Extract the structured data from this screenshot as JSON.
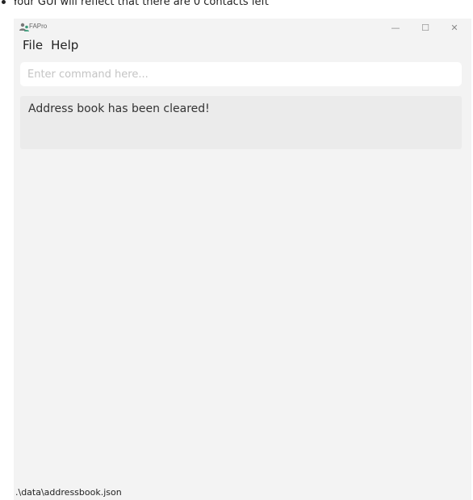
{
  "instruction": {
    "text": "Your GUI will reflect that there are 0 contacts left"
  },
  "window": {
    "title": "FAPro",
    "controls": {
      "minimize_glyph": "—",
      "maximize_glyph": "☐",
      "close_glyph": "✕"
    },
    "menu": [
      {
        "label": "File"
      },
      {
        "label": "Help"
      }
    ],
    "command": {
      "value": "",
      "placeholder": "Enter command here..."
    },
    "result": {
      "text": "Address book has been cleared!"
    },
    "status_bar": {
      "path": ".\\data\\addressbook.json"
    },
    "icons": {
      "app": "people-icon"
    },
    "colors": {
      "window_bg": "#f3f3f3",
      "result_bg": "#ebebeb",
      "command_bg": "#ffffff",
      "app_icon_accent": "#3a9c7a"
    }
  }
}
